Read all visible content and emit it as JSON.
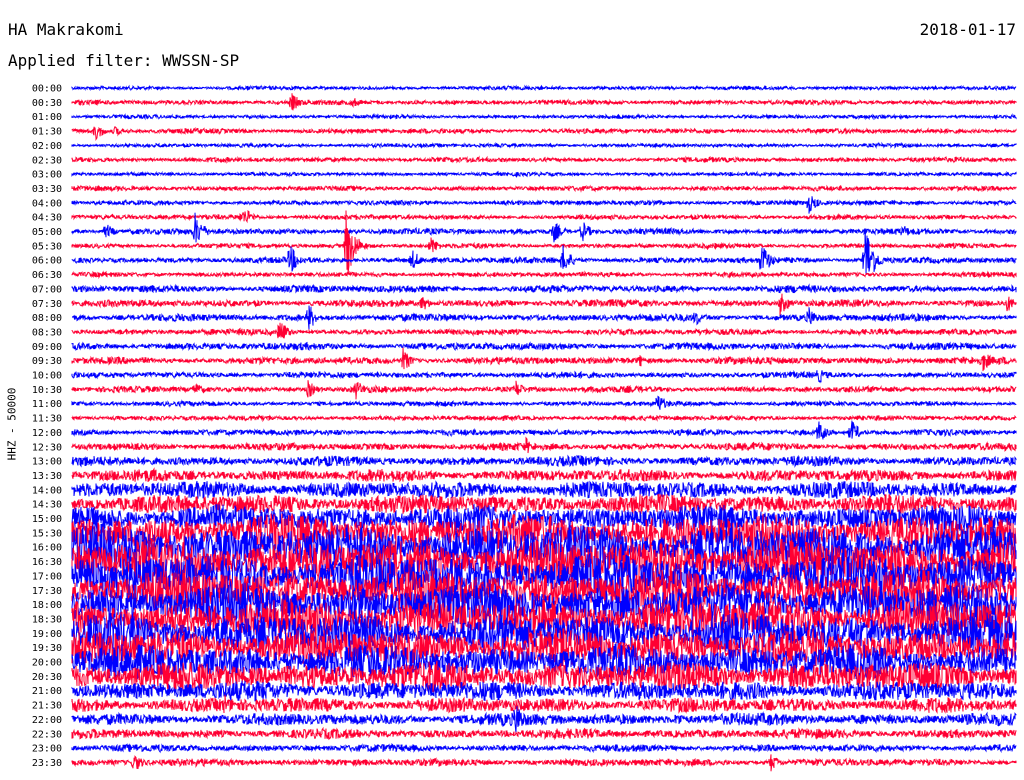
{
  "header": {
    "station": "HA Makrakomi",
    "date": "2018-01-17",
    "filter": "Applied filter: WWSSN-SP"
  },
  "chart_data": {
    "type": "line",
    "title": "HA Makrakomi",
    "ylabel": "HHZ - 50000",
    "hours": [
      "00:00",
      "00:30",
      "01:00",
      "01:30",
      "02:00",
      "02:30",
      "03:00",
      "03:30",
      "04:00",
      "04:30",
      "05:00",
      "05:30",
      "06:00",
      "06:30",
      "07:00",
      "07:30",
      "08:00",
      "08:30",
      "09:00",
      "09:30",
      "10:00",
      "10:30",
      "11:00",
      "11:30",
      "12:00",
      "12:30",
      "13:00",
      "13:30",
      "14:00",
      "14:30",
      "15:00",
      "15:30",
      "16:00",
      "16:30",
      "17:00",
      "17:30",
      "18:00",
      "18:30",
      "19:00",
      "19:30",
      "20:00",
      "20:30",
      "21:00",
      "21:30",
      "22:00",
      "22:30",
      "23:00",
      "23:30"
    ],
    "trace_colors": [
      "#0000ff",
      "#ff0033"
    ],
    "trace_amplitude": [
      1.5,
      2,
      1.5,
      2,
      1.5,
      2,
      1.5,
      2,
      2,
      2,
      2.5,
      2,
      2.5,
      2,
      3,
      3,
      3,
      2.5,
      3,
      3,
      2.5,
      2.5,
      2,
      2,
      2.5,
      3,
      4,
      5,
      7,
      8,
      11,
      15,
      18,
      18,
      18,
      17,
      17,
      16,
      16,
      15,
      14,
      12,
      8,
      6,
      5,
      4,
      3,
      3
    ],
    "events": [
      {
        "trace": "00:30",
        "t": 0.233,
        "amp": 10
      },
      {
        "trace": "00:30",
        "t": 0.297,
        "amp": 6
      },
      {
        "trace": "01:30",
        "t": 0.025,
        "amp": 10
      },
      {
        "trace": "01:30",
        "t": 0.045,
        "amp": 6
      },
      {
        "trace": "04:00",
        "t": 0.78,
        "amp": 12
      },
      {
        "trace": "04:30",
        "t": 0.18,
        "amp": 8
      },
      {
        "trace": "04:30",
        "t": 0.183,
        "amp": 10
      },
      {
        "trace": "05:00",
        "t": 0.035,
        "amp": 10
      },
      {
        "trace": "05:00",
        "t": 0.13,
        "amp": 20
      },
      {
        "trace": "05:00",
        "t": 0.51,
        "amp": 12
      },
      {
        "trace": "05:00",
        "t": 0.54,
        "amp": 12
      },
      {
        "trace": "05:00",
        "t": 0.88,
        "amp": 8
      },
      {
        "trace": "05:30",
        "t": 0.29,
        "amp": 40
      },
      {
        "trace": "05:30",
        "t": 0.38,
        "amp": 10
      },
      {
        "trace": "06:00",
        "t": 0.23,
        "amp": 18
      },
      {
        "trace": "06:00",
        "t": 0.36,
        "amp": 12
      },
      {
        "trace": "06:00",
        "t": 0.52,
        "amp": 16
      },
      {
        "trace": "06:00",
        "t": 0.73,
        "amp": 20
      },
      {
        "trace": "06:00",
        "t": 0.84,
        "amp": 40
      },
      {
        "trace": "07:30",
        "t": 0.37,
        "amp": 10
      },
      {
        "trace": "07:30",
        "t": 0.75,
        "amp": 14
      },
      {
        "trace": "07:30",
        "t": 0.99,
        "amp": 10
      },
      {
        "trace": "08:00",
        "t": 0.25,
        "amp": 16
      },
      {
        "trace": "08:00",
        "t": 0.66,
        "amp": 10
      },
      {
        "trace": "08:00",
        "t": 0.78,
        "amp": 12
      },
      {
        "trace": "08:30",
        "t": 0.22,
        "amp": 14
      },
      {
        "trace": "09:30",
        "t": 0.35,
        "amp": 14
      },
      {
        "trace": "09:30",
        "t": 0.6,
        "amp": 8
      },
      {
        "trace": "09:30",
        "t": 0.965,
        "amp": 12
      },
      {
        "trace": "10:00",
        "t": 0.79,
        "amp": 10
      },
      {
        "trace": "10:30",
        "t": 0.13,
        "amp": 8
      },
      {
        "trace": "10:30",
        "t": 0.25,
        "amp": 10
      },
      {
        "trace": "10:30",
        "t": 0.3,
        "amp": 12
      },
      {
        "trace": "10:30",
        "t": 0.47,
        "amp": 10
      },
      {
        "trace": "11:00",
        "t": 0.62,
        "amp": 12
      },
      {
        "trace": "12:00",
        "t": 0.79,
        "amp": 14
      },
      {
        "trace": "12:00",
        "t": 0.825,
        "amp": 14
      },
      {
        "trace": "12:30",
        "t": 0.48,
        "amp": 10
      },
      {
        "trace": "13:00",
        "t": 0.76,
        "amp": 12
      },
      {
        "trace": "21:30",
        "t": 0.16,
        "amp": 14
      },
      {
        "trace": "22:00",
        "t": 0.47,
        "amp": 20
      },
      {
        "trace": "22:00",
        "t": 0.64,
        "amp": 10
      },
      {
        "trace": "23:30",
        "t": 0.065,
        "amp": 12
      },
      {
        "trace": "23:30",
        "t": 0.74,
        "amp": 10
      }
    ]
  }
}
